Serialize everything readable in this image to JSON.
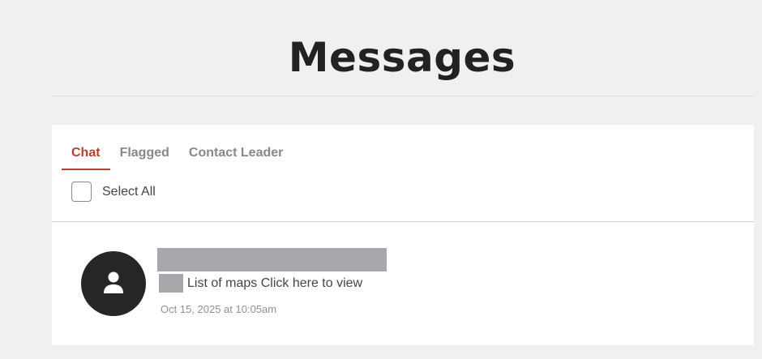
{
  "page": {
    "title": "Messages"
  },
  "tabs": [
    {
      "label": "Chat",
      "active": true
    },
    {
      "label": "Flagged",
      "active": false
    },
    {
      "label": "Contact Leader",
      "active": false
    }
  ],
  "select_all": {
    "label": "Select All",
    "checked": false
  },
  "messages": [
    {
      "avatar_icon": "user-icon",
      "preview": "List of maps Click here to view",
      "timestamp": "Oct 15, 2025 at 10:05am"
    }
  ],
  "colors": {
    "accent": "#b4412d",
    "avatar_bg": "#262626",
    "redaction": "#a7a8ac",
    "page_bg": "#f0f0f0"
  }
}
